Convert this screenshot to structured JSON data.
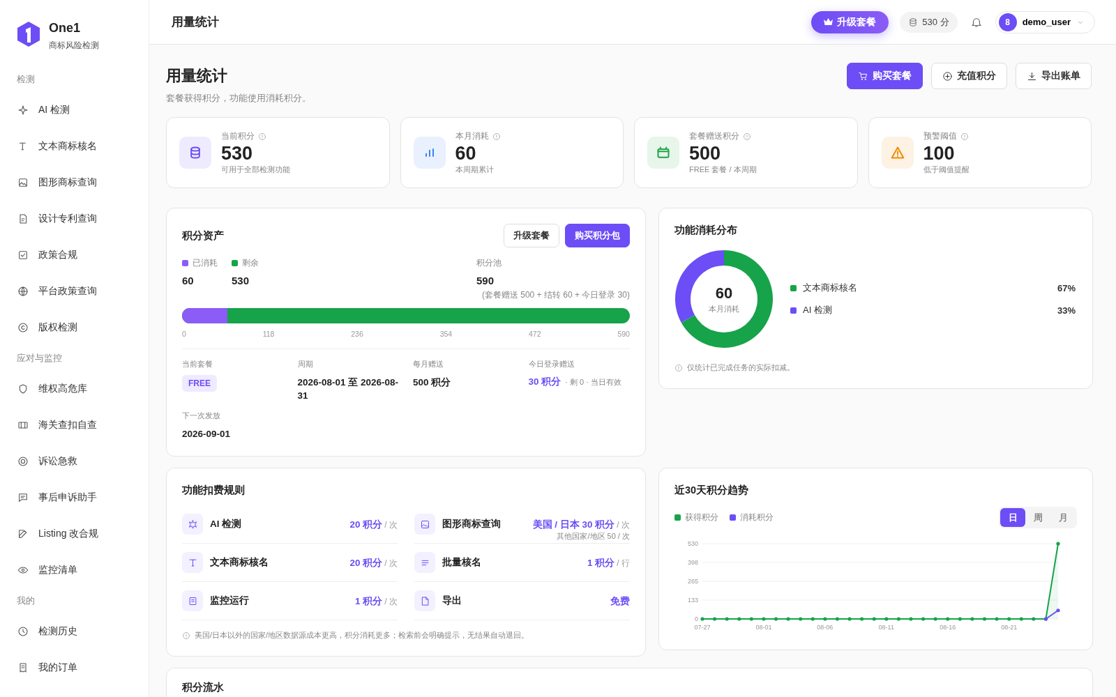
{
  "sidebar": {
    "brand": {
      "name": "One1",
      "tagline": "商标风险检测"
    },
    "sections": [
      {
        "title": "检测",
        "items": [
          {
            "label": "AI 检测",
            "selected": false
          },
          {
            "label": "文本商标核名",
            "selected": false
          },
          {
            "label": "图形商标查询",
            "selected": false
          },
          {
            "label": "设计专利查询",
            "selected": false
          },
          {
            "label": "政策合规",
            "selected": false
          },
          {
            "label": "平台政策查询",
            "selected": false
          },
          {
            "label": "版权检测",
            "selected": false
          }
        ]
      },
      {
        "title": "应对与监控",
        "items": [
          {
            "label": "维权高危库",
            "selected": false
          },
          {
            "label": "海关查扣自查",
            "selected": false
          },
          {
            "label": "诉讼急救",
            "selected": false
          },
          {
            "label": "事后申诉助手",
            "selected": false
          },
          {
            "label": "Listing 改合规",
            "selected": false
          },
          {
            "label": "监控清单",
            "selected": false
          }
        ]
      },
      {
        "title": "我的",
        "items": [
          {
            "label": "检测历史",
            "selected": false
          },
          {
            "label": "我的订单",
            "selected": false
          }
        ]
      }
    ]
  },
  "header": {
    "title": "用量统计",
    "upgrade_button": "升级套餐",
    "points_chip": "530 分",
    "user": {
      "avatar": "8",
      "name": "demo_user"
    }
  },
  "page": {
    "title": "用量统计",
    "subtitle": "套餐获得积分，功能使用消耗积分。",
    "actions": [
      {
        "label": "购买套餐",
        "kind": "primary"
      },
      {
        "label": "充值积分",
        "kind": "outline"
      },
      {
        "label": "导出账单",
        "kind": "outline"
      }
    ]
  },
  "stats": [
    {
      "label": "当前积分",
      "value": "530",
      "note": "可用于全部检测功能",
      "color": "#6c4df6"
    },
    {
      "label": "本月消耗",
      "value": "60",
      "note": "本周期累计",
      "color": "#3b82f6"
    },
    {
      "label": "套餐赠送积分",
      "value": "500",
      "note": "FREE 套餐 / 本周期",
      "color": "#22a447"
    },
    {
      "label": "预警阈值",
      "value": "100",
      "note": "低于阈值提醒",
      "color": "#f08c00"
    }
  ],
  "assets": {
    "title": "积分资产",
    "buttons": [
      {
        "label": "升级套餐",
        "kind": "outline"
      },
      {
        "label": "购买积分包",
        "kind": "primary"
      }
    ],
    "legend": [
      {
        "label": "已消耗",
        "value": "60",
        "color": "#8b5cf6"
      },
      {
        "label": "剩余",
        "value": "530",
        "color": "#16a34a"
      }
    ],
    "pool": {
      "label": "积分池",
      "value": "590",
      "breakdown": "(套餐赠送 500 + 结转 60 + 今日登录 30)"
    },
    "bar": {
      "level": 0.1017
    },
    "ticks": [
      "0",
      "118",
      "236",
      "354",
      "472",
      "590"
    ],
    "details": [
      {
        "label": "当前套餐",
        "value": "FREE",
        "kind": "badge"
      },
      {
        "label": "周期",
        "value": "2026-08-01 至 2026-08-31",
        "kind": "text"
      },
      {
        "label": "每月赠送",
        "value": "500 积分",
        "kind": "text"
      },
      {
        "label": "今日登录赠送",
        "value": "30 积分",
        "extra": "· 剩 0 · 当日有效",
        "kind": "highlight"
      },
      {
        "label": "下一次发放",
        "value": "2026-09-01",
        "kind": "text"
      }
    ]
  },
  "distribution": {
    "title": "功能消耗分布",
    "center_value": "60",
    "center_label": "本月消耗",
    "chart_data": {
      "type": "donut",
      "categories": [
        "文本商标核名",
        "AI 检测"
      ],
      "values": [
        67,
        33
      ],
      "colors": [
        "#16a34a",
        "#6c4df6"
      ],
      "value_labels": [
        "67%",
        "33%"
      ]
    },
    "note": "仅统计已完成任务的实际扣减。"
  },
  "rules": {
    "title": "功能扣费规则",
    "items": [
      {
        "name": "AI 检测",
        "price": "20 积分",
        "unit": "/ 次"
      },
      {
        "name": "图形商标查询",
        "price": "美国 / 日本 30 积分",
        "unit": "/ 次",
        "sub": "其他国家/地区 50 / 次"
      },
      {
        "name": "文本商标核名",
        "price": "20 积分",
        "unit": "/ 次"
      },
      {
        "name": "批量核名",
        "price": "1 积分",
        "unit": "/ 行"
      },
      {
        "name": "监控运行",
        "price": "1 积分",
        "unit": "/ 次"
      },
      {
        "name": "导出",
        "price": "免费"
      }
    ],
    "note": "美国/日本以外的国家/地区数据源成本更高，积分消耗更多；检索前会明确提示，无结果自动退回。"
  },
  "trend": {
    "title": "近30天积分趋势",
    "periods": [
      {
        "label": "日",
        "selected": true
      },
      {
        "label": "周",
        "selected": false
      },
      {
        "label": "月",
        "selected": false
      }
    ],
    "chart_data": {
      "type": "line",
      "categories": [
        "07-27",
        null,
        null,
        null,
        null,
        "08-01",
        null,
        null,
        null,
        null,
        "08-06",
        null,
        null,
        null,
        null,
        "08-11",
        null,
        null,
        null,
        null,
        "08-16",
        null,
        null,
        null,
        null,
        "08-21",
        null,
        null,
        null,
        null
      ],
      "grid": true,
      "series": [
        {
          "name": "获得积分",
          "color": "#16a34a",
          "values": [
            0,
            0,
            0,
            0,
            0,
            0,
            0,
            0,
            0,
            0,
            0,
            0,
            0,
            0,
            0,
            0,
            0,
            0,
            0,
            0,
            0,
            0,
            0,
            0,
            0,
            0,
            0,
            0,
            0,
            530
          ]
        },
        {
          "name": "消耗积分",
          "color": "#6c4df6",
          "values": [
            null,
            null,
            null,
            null,
            null,
            null,
            null,
            null,
            null,
            null,
            null,
            null,
            null,
            null,
            null,
            null,
            null,
            null,
            null,
            null,
            null,
            null,
            null,
            null,
            null,
            null,
            null,
            null,
            0,
            60
          ]
        }
      ],
      "ylim": [
        0,
        530
      ],
      "yticks": [
        0,
        133,
        265,
        398,
        530
      ]
    }
  },
  "ledger": {
    "title": "积分流水"
  }
}
